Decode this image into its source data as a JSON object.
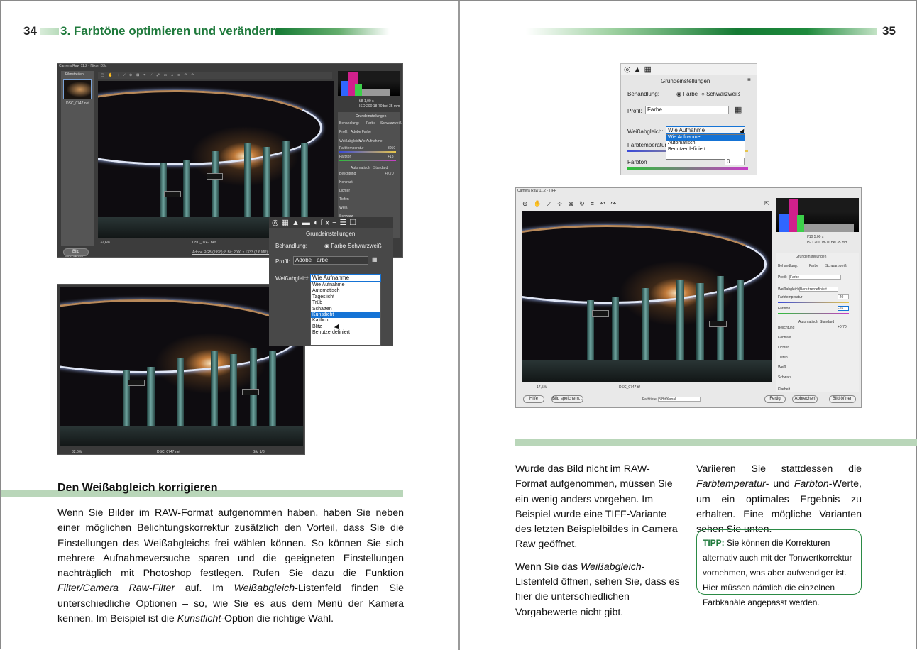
{
  "left_page": {
    "number": "34",
    "chapter_title": "3. Farbtöne optimieren und verändern",
    "heading": "Den Weißabgleich korrigieren",
    "body_p1": "Wenn Sie Bilder im RAW-Format aufgenommen haben, haben Sie neben einer möglichen Belichtungskorrektur zusätzlich den Vorteil, dass Sie die Einstellungen des Weißabgleichs frei wählen können. So können Sie sich mehrere Aufnahmeversuche sparen und die geeigneten Einstellungen nachträglich mit Photoshop festlegen. Rufen Sie dazu die Funktion ",
    "body_em1": "Filter/Camera Raw-Filter",
    "body_p2": " auf. Im ",
    "body_em2": "Weißabgleich",
    "body_p3": "-Listenfeld finden Sie unterschiedliche Optionen – so, wie Sie es aus dem Menü der Kamera kennen. Im Beispiel ist die ",
    "body_em3": "Kunstlicht",
    "body_p4": "-Option die richtige Wahl."
  },
  "right_page": {
    "number": "35",
    "col1_p1": "Wurde das Bild nicht im RAW-Format aufgenommen, müssen Sie ein wenig anders vorgehen. Im Beispiel wurde eine TIFF-Variante des letzten Beispielbildes in Camera Raw geöffnet.",
    "col1_p2a": "Wenn Sie das ",
    "col1_p2em": "Weißabgleich",
    "col1_p2b": "-Listenfeld öffnen, sehen Sie, dass es hier die unterschiedlichen Vorgabewerte nicht gibt.",
    "col2_a": "Variieren Sie stattdessen die ",
    "col2_em1": "Farbtemperatur-",
    "col2_b": " und ",
    "col2_em2": "Farbton",
    "col2_c": "-Werte, um ein optimales Ergebnis zu erhalten. Eine mögliche Varianten sehen Sie unten.",
    "tip_label": "TIPP:",
    "tip_text": " Sie können die Korrekturen alternativ auch mit der Tonwertkorrektur vornehmen, was aber aufwendiger ist. Hier müssen nämlich die einzelnen Farbkanäle angepasst werden."
  },
  "screenshot_left": {
    "window_title": "Camera Raw 11.2 - Nikon D3x",
    "filmstrip_label": "Filmstreifen",
    "zoom": "32,6%",
    "filename": "DSC_0747.nef",
    "status_line": "Adobe RGB (1998); 8 Bit; 2000 x 1333 (2,6 MP); 300 ppi",
    "save_button": "Bild speichern...",
    "exif_f": "f/8   1,00 s",
    "exif_iso": "ISO 200   18-70 bei 35 mm",
    "panel_title": "Grundeinstellungen",
    "treatment": "Behandlung:",
    "color": "Farbe",
    "bw": "Schwarzweiß",
    "profile": "Profil:",
    "profile_value": "Adobe Farbe",
    "wb": "Weißabgleich:",
    "wb_value": "Wie Aufnahme",
    "temp": "Farbtemperatur",
    "temp_value": "3050",
    "tint": "Farbton",
    "tint_value": "+18",
    "auto": "Automatisch",
    "standard": "Standard",
    "exposure": "Belichtung",
    "exposure_value": "+0,70",
    "contrast": "Kontrast",
    "highlights": "Lichter",
    "shadows": "Tiefen",
    "whites": "Weiß",
    "blacks": "Schwarz",
    "zero": "0"
  },
  "zoom_left": {
    "panel_title": "Grundeinstellungen",
    "treatment": "Behandlung:",
    "color": "Farbe",
    "bw": "Schwarzweiß",
    "profile": "Profil:",
    "profile_value": "Adobe Farbe",
    "wb": "Weißabgleich:",
    "wb_value": "Wie Aufnahme",
    "options": [
      "Wie Aufnahme",
      "Automatisch",
      "Tageslicht",
      "Trüb",
      "Schatten",
      "Kunstlicht",
      "Kaltlicht",
      "Blitz",
      "Benutzerdefiniert"
    ],
    "selected_index": 5
  },
  "screenshot_left2": {
    "zoom": "32,6%",
    "filename": "DSC_0747.nef",
    "pager": "Bild 1/3"
  },
  "zoom_right": {
    "panel_title": "Grundeinstellungen",
    "treatment": "Behandlung:",
    "color": "Farbe",
    "bw": "Schwarzweiß",
    "profile": "Profil:",
    "profile_value": "Farbe",
    "wb": "Weißabgleich:",
    "wb_value": "Wie Aufnahme",
    "options": [
      "Wie Aufnahme",
      "Automatisch",
      "Benutzerdefiniert"
    ],
    "temp": "Farbtemperatur",
    "tint": "Farbton",
    "tint_value": "0"
  },
  "screenshot_right": {
    "window_title": "Camera Raw 11.2 - TIFF",
    "exif_f": "f/10   5,00 s",
    "exif_iso": "ISO 200   18-70 bei 35 mm",
    "panel_title": "Grundeinstellungen",
    "treatment": "Behandlung:",
    "color": "Farbe",
    "bw": "Schwarzweiß",
    "profile": "Profil:",
    "profile_value": "Farbe",
    "wb": "Weißabgleich:",
    "wb_value": "Benutzerdefiniert",
    "temp": "Farbtemperatur",
    "temp_value": "-20",
    "tint": "Farbton",
    "tint_value": "-16",
    "auto": "Automatisch",
    "standard": "Standard",
    "exposure": "Belichtung",
    "exposure_value": "+0,70",
    "contrast": "Kontrast",
    "highlights": "Lichter",
    "shadows": "Tiefen",
    "whites": "Weiß",
    "blacks": "Schwarz",
    "clarity": "Klarheit",
    "zero": "0",
    "zoom": "17,5%",
    "filename": "DSC_0747.tif",
    "depth_label": "Farbtiefe:",
    "depth_value": "8 Bit/Kanal",
    "help": "Hilfe",
    "save": "Bild speichern...",
    "done": "Fertig",
    "cancel": "Abbrechen",
    "open": "Bild öffnen"
  }
}
